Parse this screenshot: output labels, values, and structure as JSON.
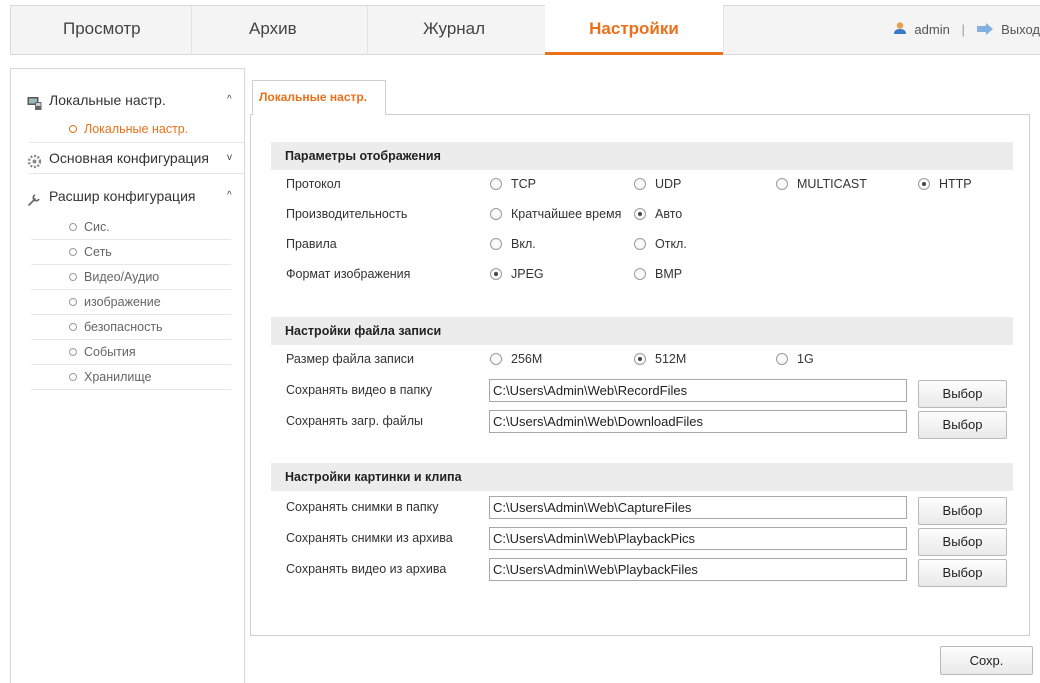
{
  "nav": {
    "tabs": [
      {
        "label": "Просмотр"
      },
      {
        "label": "Архив"
      },
      {
        "label": "Журнал"
      },
      {
        "label": "Настройки"
      }
    ],
    "user": "admin",
    "separator": "|",
    "logout": "Выход",
    "accent_color": "#e8711a"
  },
  "sidebar": {
    "groups": [
      {
        "label": "Локальные настр.",
        "chevron": "^",
        "icon": "monitor-icon"
      },
      {
        "label": "Основная конфигурация",
        "chevron": "v",
        "icon": "gear-icon"
      },
      {
        "label": "Расшир конфигурация",
        "chevron": "^",
        "icon": "wrench-icon"
      }
    ],
    "local_items": [
      "Локальные настр."
    ],
    "advanced_items": [
      "Сис.",
      "Сеть",
      "Видео/Аудио",
      "изображение",
      "безопасность",
      "События",
      "Хранилище"
    ]
  },
  "content": {
    "tab_label": "Локальные настр.",
    "display": {
      "title": "Параметры отображения",
      "protocol": {
        "label": "Протокол",
        "options": [
          "TCP",
          "UDP",
          "MULTICAST",
          "HTTP"
        ],
        "selected": "HTTP"
      },
      "performance": {
        "label": "Производительность",
        "options": [
          "Кратчайшее время",
          "Авто"
        ],
        "selected": "Авто"
      },
      "rules": {
        "label": "Правила",
        "options": [
          "Вкл.",
          "Откл."
        ],
        "selected": ""
      },
      "image_format": {
        "label": "Формат изображения",
        "options": [
          "JPEG",
          "BMP"
        ],
        "selected": "JPEG"
      }
    },
    "record": {
      "title": "Настройки файла записи",
      "size": {
        "label": "Размер файла записи",
        "options": [
          "256M",
          "512M",
          "1G"
        ],
        "selected": "512M"
      },
      "video_folder": {
        "label": "Сохранять видео в папку",
        "value": "C:\\Users\\Admin\\Web\\RecordFiles"
      },
      "download_folder": {
        "label": "Сохранять загр. файлы",
        "value": "C:\\Users\\Admin\\Web\\DownloadFiles"
      }
    },
    "capture": {
      "title": "Настройки картинки и клипа",
      "snap_folder": {
        "label": "Сохранять снимки в папку",
        "value": "C:\\Users\\Admin\\Web\\CaptureFiles"
      },
      "playback_snap_folder": {
        "label": "Сохранять снимки из архива",
        "value": "C:\\Users\\Admin\\Web\\PlaybackPics"
      },
      "playback_video_folder": {
        "label": "Сохранять видео из архива",
        "value": "C:\\Users\\Admin\\Web\\PlaybackFiles"
      }
    },
    "browse_label": "Выбор",
    "save_label": "Сохр."
  }
}
